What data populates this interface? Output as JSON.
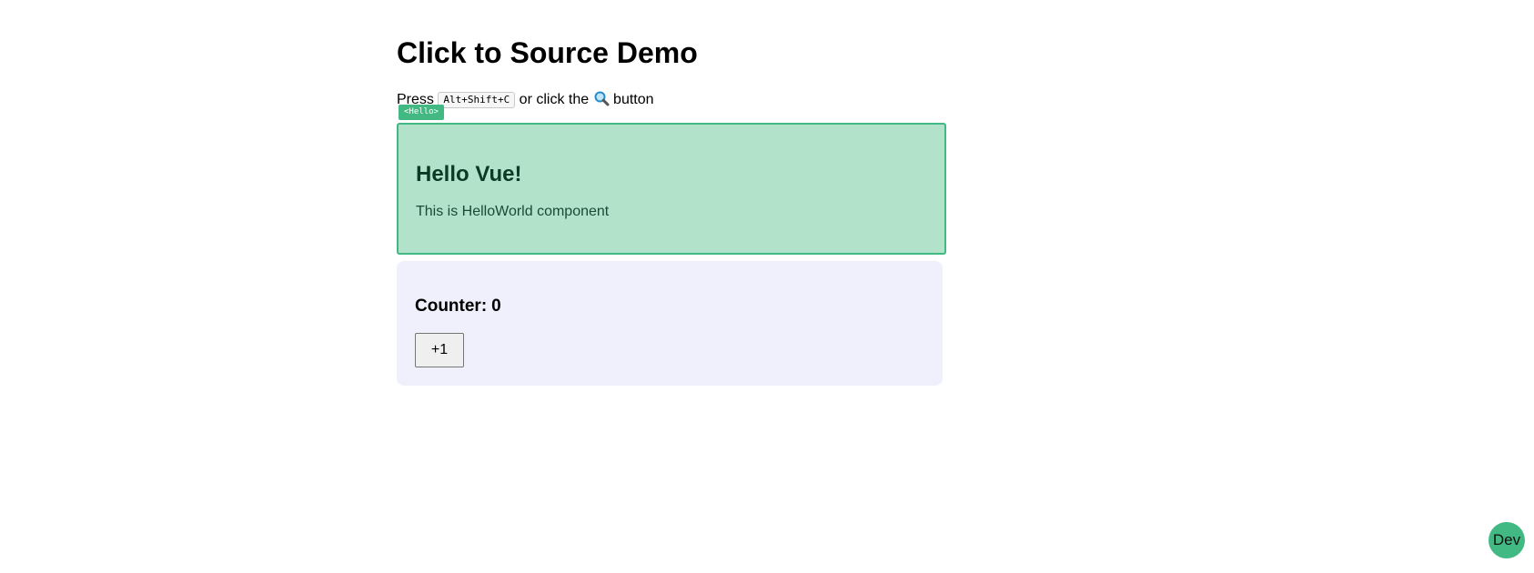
{
  "page": {
    "title": "Click to Source Demo"
  },
  "instructions": {
    "prefix": "Press",
    "shortcut": "Alt+Shift+C",
    "middle": "or click the",
    "icon": "search-icon",
    "suffix": "button"
  },
  "hello_component": {
    "tag_badge": "<Hello>",
    "title": "Hello Vue!",
    "text": "This is HelloWorld component"
  },
  "counter": {
    "label": "Counter:",
    "value": "0",
    "button_label": "+1"
  },
  "dev_button": {
    "label": "Dev"
  },
  "colors": {
    "accent": "#42b883",
    "hello_background": "#b2e3ca",
    "counter_background": "#f0f0fc"
  }
}
